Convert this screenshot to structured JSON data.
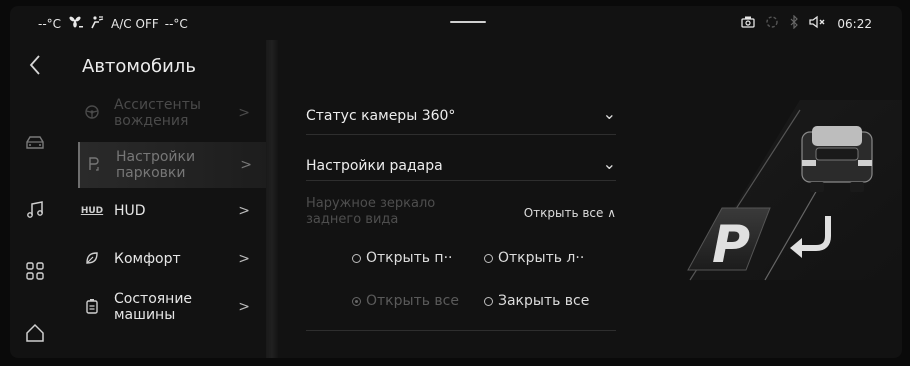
{
  "status_bar": {
    "left_temp": "--°C",
    "ac_label": "A/C OFF",
    "right_temp": "--°C",
    "time": "06:22",
    "icons": [
      "fan-icon",
      "seat-airflow-icon",
      "camera-icon",
      "loading-icon",
      "bluetooth-icon",
      "mute-icon"
    ]
  },
  "rail": {
    "icons": [
      "back-icon",
      "car-icon",
      "music-icon",
      "apps-icon",
      "home-icon"
    ]
  },
  "nav": {
    "title": "Автомобиль",
    "items": [
      {
        "label": "Ассистенты вождения",
        "icon": "steering-wheel-icon",
        "state": "disabled"
      },
      {
        "label": "Настройки парковки",
        "icon": "parking-icon",
        "state": "selected"
      },
      {
        "label": "HUD",
        "icon_text": "HUD",
        "state": "normal"
      },
      {
        "label": "Комфорт",
        "icon": "comfort-leaf-icon",
        "state": "normal"
      },
      {
        "label": "Состояние машины",
        "icon": "vehicle-status-icon",
        "state": "normal"
      }
    ],
    "chevron": ">"
  },
  "settings": {
    "camera_status": "Статус камеры 360°",
    "radar_settings": "Настройки радара",
    "mirror_label": "Наружное зеркало заднего вида",
    "mirror_value": "Открыть все ∧",
    "options": [
      {
        "label": "Открыть п··",
        "selected": false,
        "enabled": true
      },
      {
        "label": "Открыть л··",
        "selected": false,
        "enabled": true
      },
      {
        "label": "Открыть все",
        "selected": true,
        "enabled": false
      },
      {
        "label": "Закрыть все",
        "selected": false,
        "enabled": true
      }
    ],
    "chevron_down": "⌄"
  },
  "colors": {
    "background": "#121212",
    "text": "#e6e6e6",
    "disabled": "#4a4a4a",
    "divider": "#2e2e2e"
  }
}
